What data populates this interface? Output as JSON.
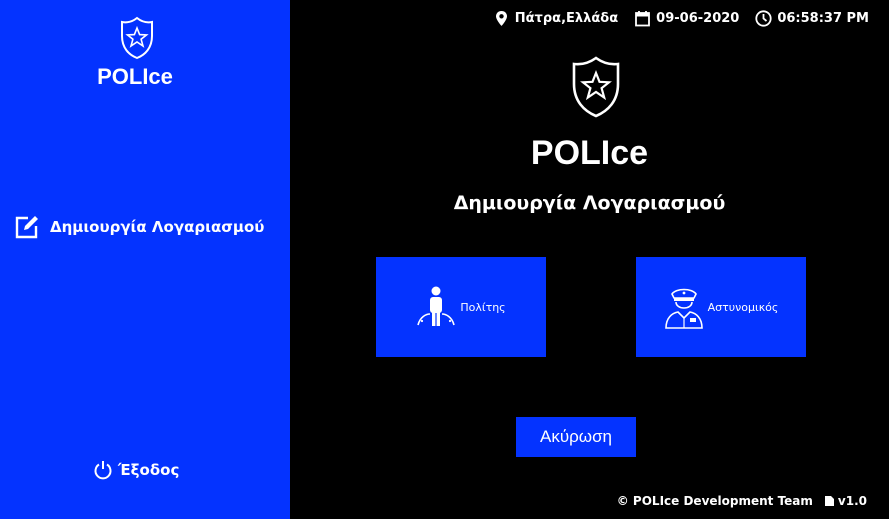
{
  "sidebar": {
    "brand": "POLIce",
    "logo_icon": "police-badge-icon",
    "nav": {
      "label": "Δημιουργία Λογαριασμού",
      "icon": "edit-icon"
    },
    "logout": {
      "label": "Έξοδος",
      "icon": "power-icon"
    }
  },
  "topbar": {
    "location": "Πάτρα,Ελλάδα",
    "date": "09-06-2020",
    "time": "06:58:37 PM"
  },
  "main": {
    "brand": "POLIce",
    "subtitle": "Δημιουργία Λογαριασμού",
    "roles": {
      "citizen": {
        "label": "Πολίτης",
        "icon": "citizen-icon"
      },
      "officer": {
        "label": "Αστυνομικός",
        "icon": "police-officer-icon"
      }
    },
    "cancel_label": "Ακύρωση"
  },
  "footer": {
    "credit": "© POLIce Development Team",
    "version": "v1.0"
  },
  "colors": {
    "accent": "#0433ff",
    "background": "#000000",
    "text": "#ffffff"
  }
}
